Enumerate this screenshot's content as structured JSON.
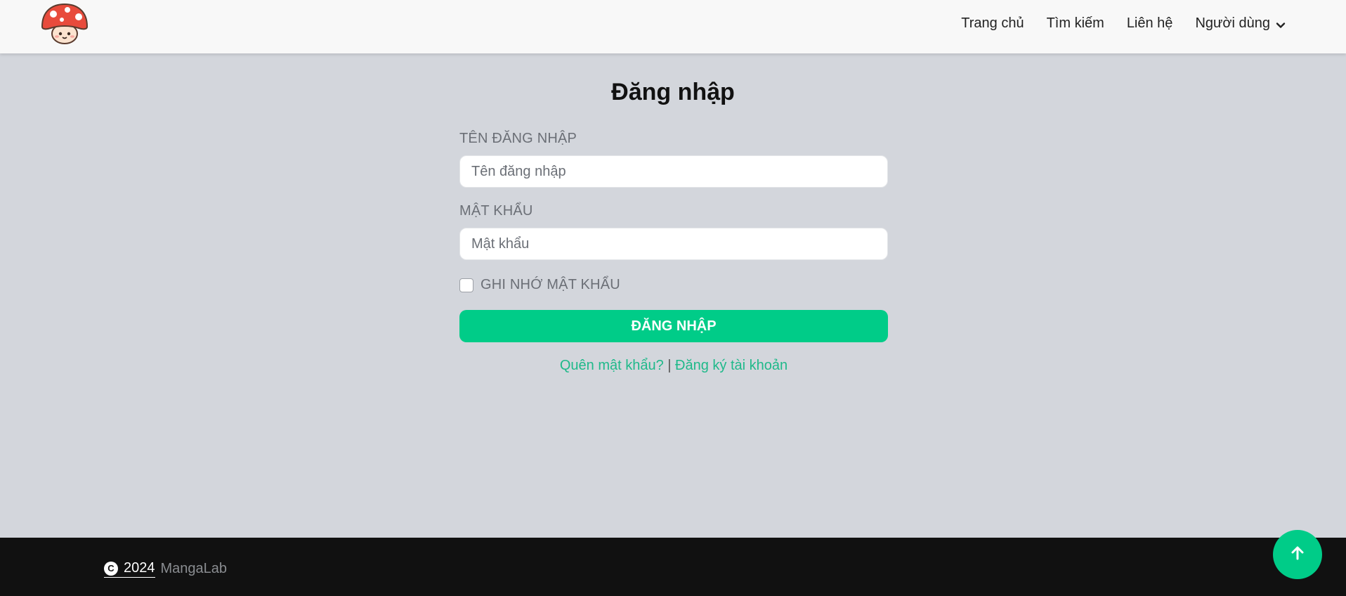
{
  "nav": {
    "logo_alt": "MangaLab mushroom logo",
    "links": [
      "Trang chủ",
      "Tìm kiếm",
      "Liên hệ"
    ],
    "user_menu_label": "Người dùng",
    "user_menu_icon": "chevron-down-icon"
  },
  "login": {
    "title": "Đăng nhập",
    "username_label": "TÊN ĐĂNG NHẬP",
    "username_placeholder": "Tên đăng nhập",
    "username_value": "",
    "password_label": "MẬT KHẨU",
    "password_placeholder": "Mật khẩu",
    "password_value": "",
    "remember_label": "GHI NHỚ MẬT KHẨU",
    "remember_checked": false,
    "submit_label": "ĐĂNG NHẬP",
    "forgot_link": "Quên mật khẩu?",
    "separator": "|",
    "register_link": "Đăng ký tài khoản"
  },
  "footer": {
    "copyright_symbol": "C",
    "year": "2024",
    "brand": "MangaLab"
  },
  "back_to_top_icon": "arrow-up-icon",
  "colors": {
    "accent": "#00cc88",
    "background": "#d3d6dc",
    "navbar": "#f8f8f8",
    "footer": "#111111"
  }
}
